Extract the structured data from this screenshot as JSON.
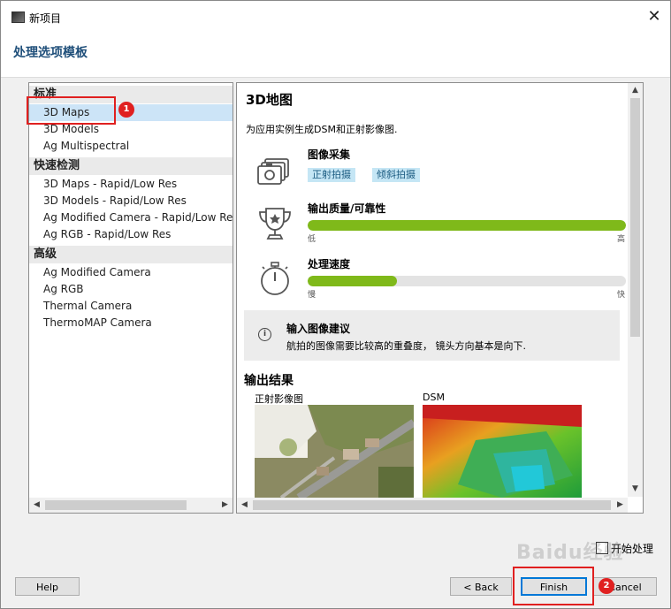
{
  "window": {
    "title": "新项目",
    "close_glyph": "✕"
  },
  "page_title": "处理选项模板",
  "templates": {
    "groups": [
      {
        "label": "标准",
        "items": [
          "3D Maps",
          "3D Models",
          "Ag Multispectral"
        ]
      },
      {
        "label": "快速检测",
        "items": [
          "3D Maps - Rapid/Low Res",
          "3D Models - Rapid/Low Res",
          "Ag Modified Camera - Rapid/Low Res",
          "Ag RGB - Rapid/Low Res"
        ]
      },
      {
        "label": "高级",
        "items": [
          "Ag Modified Camera",
          "Ag RGB",
          "Thermal Camera",
          "ThermoMAP Camera"
        ]
      }
    ],
    "selected": "3D Maps"
  },
  "detail": {
    "title": "3D地图",
    "description": "为应用实例生成DSM和正射影像图.",
    "capture": {
      "label": "图像采集",
      "tags": [
        "正射拍摄",
        "倾斜拍摄"
      ]
    },
    "quality": {
      "label": "输出质量/可靠性",
      "value_pct": 100,
      "low": "低",
      "high": "高"
    },
    "speed": {
      "label": "处理速度",
      "value_pct": 28,
      "low": "慢",
      "high": "快"
    },
    "tip": {
      "title": "输入图像建议",
      "text": "航拍的图像需要比较高的重叠度， 镜头方向基本是向下.",
      "icon_glyph": "i"
    },
    "outputs": {
      "title": "输出结果",
      "items": [
        "正射影像图",
        "DSM"
      ]
    }
  },
  "footer": {
    "start_processing": "开始处理",
    "help": "Help",
    "back": "< Back",
    "finish": "Finish",
    "cancel": "Cancel"
  },
  "annotations": {
    "badge1": "1",
    "badge2": "2"
  },
  "watermark": "Baidu经验",
  "colors": {
    "accent_title": "#1f4f7a",
    "bar_green": "#7fb91a",
    "selection": "#cce4f7",
    "tag_bg": "#c5e6f5",
    "annotation_red": "#e02020"
  },
  "icons": [
    "app-icon",
    "close-icon",
    "camera-icon",
    "trophy-icon",
    "stopwatch-icon",
    "info-icon",
    "arrow-left-icon",
    "arrow-right-icon",
    "arrow-up-icon",
    "arrow-down-icon"
  ]
}
